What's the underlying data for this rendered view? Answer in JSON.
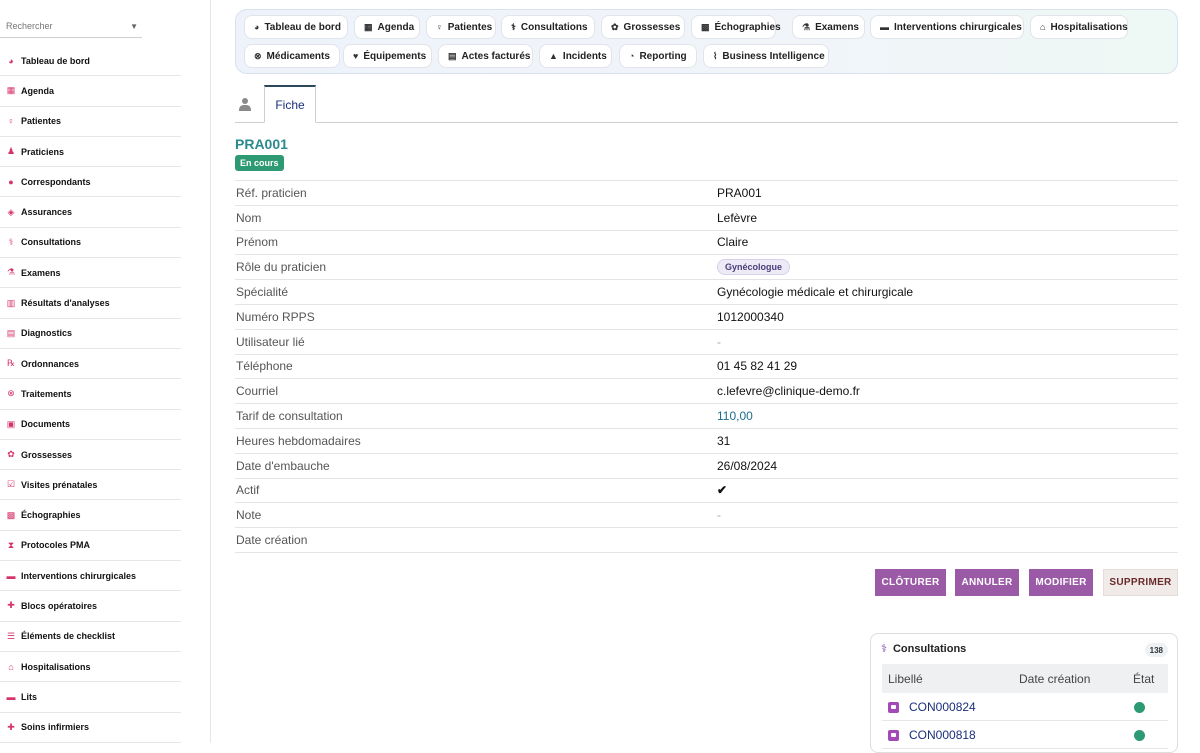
{
  "search": {
    "placeholder": "Rechercher"
  },
  "sidebar": {
    "items": [
      {
        "label": "Tableau de bord",
        "icon": "dashboard-icon"
      },
      {
        "label": "Agenda",
        "icon": "calendar-icon"
      },
      {
        "label": "Patientes",
        "icon": "female-icon"
      },
      {
        "label": "Praticiens",
        "icon": "doctor-icon"
      },
      {
        "label": "Correspondants",
        "icon": "user-icon"
      },
      {
        "label": "Assurances",
        "icon": "shield-icon"
      },
      {
        "label": "Consultations",
        "icon": "stethoscope-icon"
      },
      {
        "label": "Examens",
        "icon": "exam-icon"
      },
      {
        "label": "Résultats d'analyses",
        "icon": "lab-results-icon"
      },
      {
        "label": "Diagnostics",
        "icon": "clipboard-icon"
      },
      {
        "label": "Ordonnances",
        "icon": "prescription-icon"
      },
      {
        "label": "Traitements",
        "icon": "pills-icon"
      },
      {
        "label": "Documents",
        "icon": "document-icon"
      },
      {
        "label": "Grossesses",
        "icon": "pregnancy-icon"
      },
      {
        "label": "Visites prénatales",
        "icon": "clipboard-check-icon"
      },
      {
        "label": "Échographies",
        "icon": "ultrasound-icon"
      },
      {
        "label": "Protocoles PMA",
        "icon": "hourglass-icon"
      },
      {
        "label": "Interventions chirurgicales",
        "icon": "bed-icon"
      },
      {
        "label": "Blocs opératoires",
        "icon": "operating-room-icon"
      },
      {
        "label": "Éléments de checklist",
        "icon": "checklist-icon"
      },
      {
        "label": "Hospitalisations",
        "icon": "hospital-icon"
      },
      {
        "label": "Lits",
        "icon": "bed-icon"
      },
      {
        "label": "Soins infirmiers",
        "icon": "nursing-icon"
      }
    ]
  },
  "modules": {
    "row1": [
      {
        "label": "Tableau de bord",
        "icon": "dashboard-icon"
      },
      {
        "label": "Agenda",
        "icon": "calendar-icon"
      },
      {
        "label": "Patientes",
        "icon": "female-icon"
      },
      {
        "label": "Consultations",
        "icon": "stethoscope-icon"
      },
      {
        "label": "Grossesses",
        "icon": "pregnancy-icon"
      },
      {
        "label": "Échographies",
        "icon": "ultrasound-icon"
      },
      {
        "label": "Examens",
        "icon": "exam-icon"
      },
      {
        "label": "Interventions chirurgicales",
        "icon": "bed-icon"
      },
      {
        "label": "Hospitalisations",
        "icon": "hospital-icon"
      }
    ],
    "row2": [
      {
        "label": "Médicaments",
        "icon": "pills-icon"
      },
      {
        "label": "Équipements",
        "icon": "heart-icon"
      },
      {
        "label": "Actes facturés",
        "icon": "invoice-icon"
      },
      {
        "label": "Incidents",
        "icon": "warning-icon"
      },
      {
        "label": "Reporting",
        "icon": "pie-chart-icon"
      },
      {
        "label": "Business Intelligence",
        "icon": "line-chart-icon"
      }
    ]
  },
  "tabs": {
    "fiche": "Fiche"
  },
  "record": {
    "title": "PRA001",
    "status": "En cours",
    "fields": {
      "ref": {
        "label": "Réf. praticien",
        "value": "PRA001"
      },
      "nom": {
        "label": "Nom",
        "value": "Lefèvre"
      },
      "prenom": {
        "label": "Prénom",
        "value": "Claire"
      },
      "role": {
        "label": "Rôle du praticien",
        "value": "Gynécologue"
      },
      "specialite": {
        "label": "Spécialité",
        "value": "Gynécologie médicale et chirurgicale"
      },
      "rpps": {
        "label": "Numéro RPPS",
        "value": "1012000340"
      },
      "utilisateur": {
        "label": "Utilisateur lié",
        "value": "-"
      },
      "telephone": {
        "label": "Téléphone",
        "value": "01 45 82 41 29"
      },
      "courriel": {
        "label": "Courriel",
        "value": "c.lefevre@clinique-demo.fr"
      },
      "tarif": {
        "label": "Tarif de consultation",
        "value": "110,00"
      },
      "heures": {
        "label": "Heures hebdomadaires",
        "value": "31"
      },
      "embauche": {
        "label": "Date d'embauche",
        "value": "26/08/2024"
      },
      "actif": {
        "label": "Actif",
        "value": "✔"
      },
      "note": {
        "label": "Note",
        "value": "-"
      },
      "creation": {
        "label": "Date création",
        "value": ""
      }
    }
  },
  "actions": {
    "cloturer": "CLÔTURER",
    "annuler": "ANNULER",
    "modifier": "MODIFIER",
    "supprimer": "SUPPRIMER"
  },
  "consultations": {
    "title": "Consultations",
    "count": "138",
    "headers": {
      "libelle": "Libellé",
      "date": "Date création",
      "etat": "État"
    },
    "rows": [
      {
        "code": "CON000824",
        "status_color": "#2d9a73"
      },
      {
        "code": "CON000818",
        "status_color": "#2d9a73"
      }
    ]
  },
  "colors": {
    "accent": "#9a5aa6",
    "title": "#2b8a8f",
    "success": "#2d9a73",
    "sidebar_icon": "#d6336c"
  }
}
